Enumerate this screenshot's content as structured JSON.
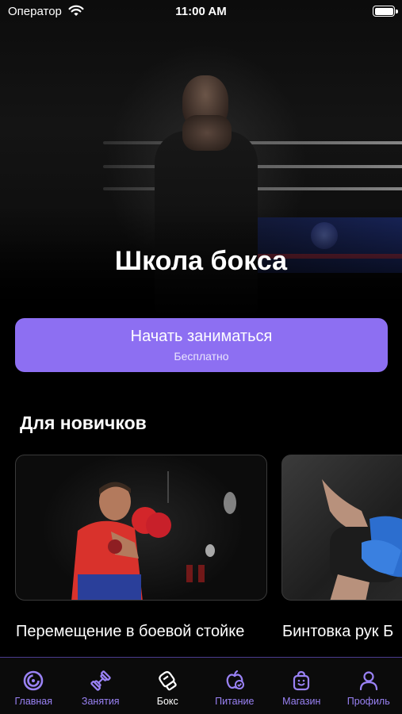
{
  "status_bar": {
    "carrier": "Оператор",
    "time": "11:00 AM"
  },
  "hero": {
    "title": "Школа бокса"
  },
  "cta": {
    "title": "Начать заниматься",
    "subtitle": "Бесплатно"
  },
  "section": {
    "title": "Для новичков"
  },
  "cards": [
    {
      "title": "Перемещение в боевой стойке"
    },
    {
      "title": "Бинтовка рук Б"
    }
  ],
  "tabbar": {
    "accent_color": "#9a82f5",
    "active_color": "#ffffff",
    "items": [
      {
        "label": "Главная",
        "icon": "home-rings-icon"
      },
      {
        "label": "Занятия",
        "icon": "dumbbell-icon"
      },
      {
        "label": "Бокс",
        "icon": "boxing-glove-icon",
        "active": true
      },
      {
        "label": "Питание",
        "icon": "apple-icon"
      },
      {
        "label": "Магазин",
        "icon": "shopping-bag-icon"
      },
      {
        "label": "Профиль",
        "icon": "user-icon"
      }
    ]
  }
}
